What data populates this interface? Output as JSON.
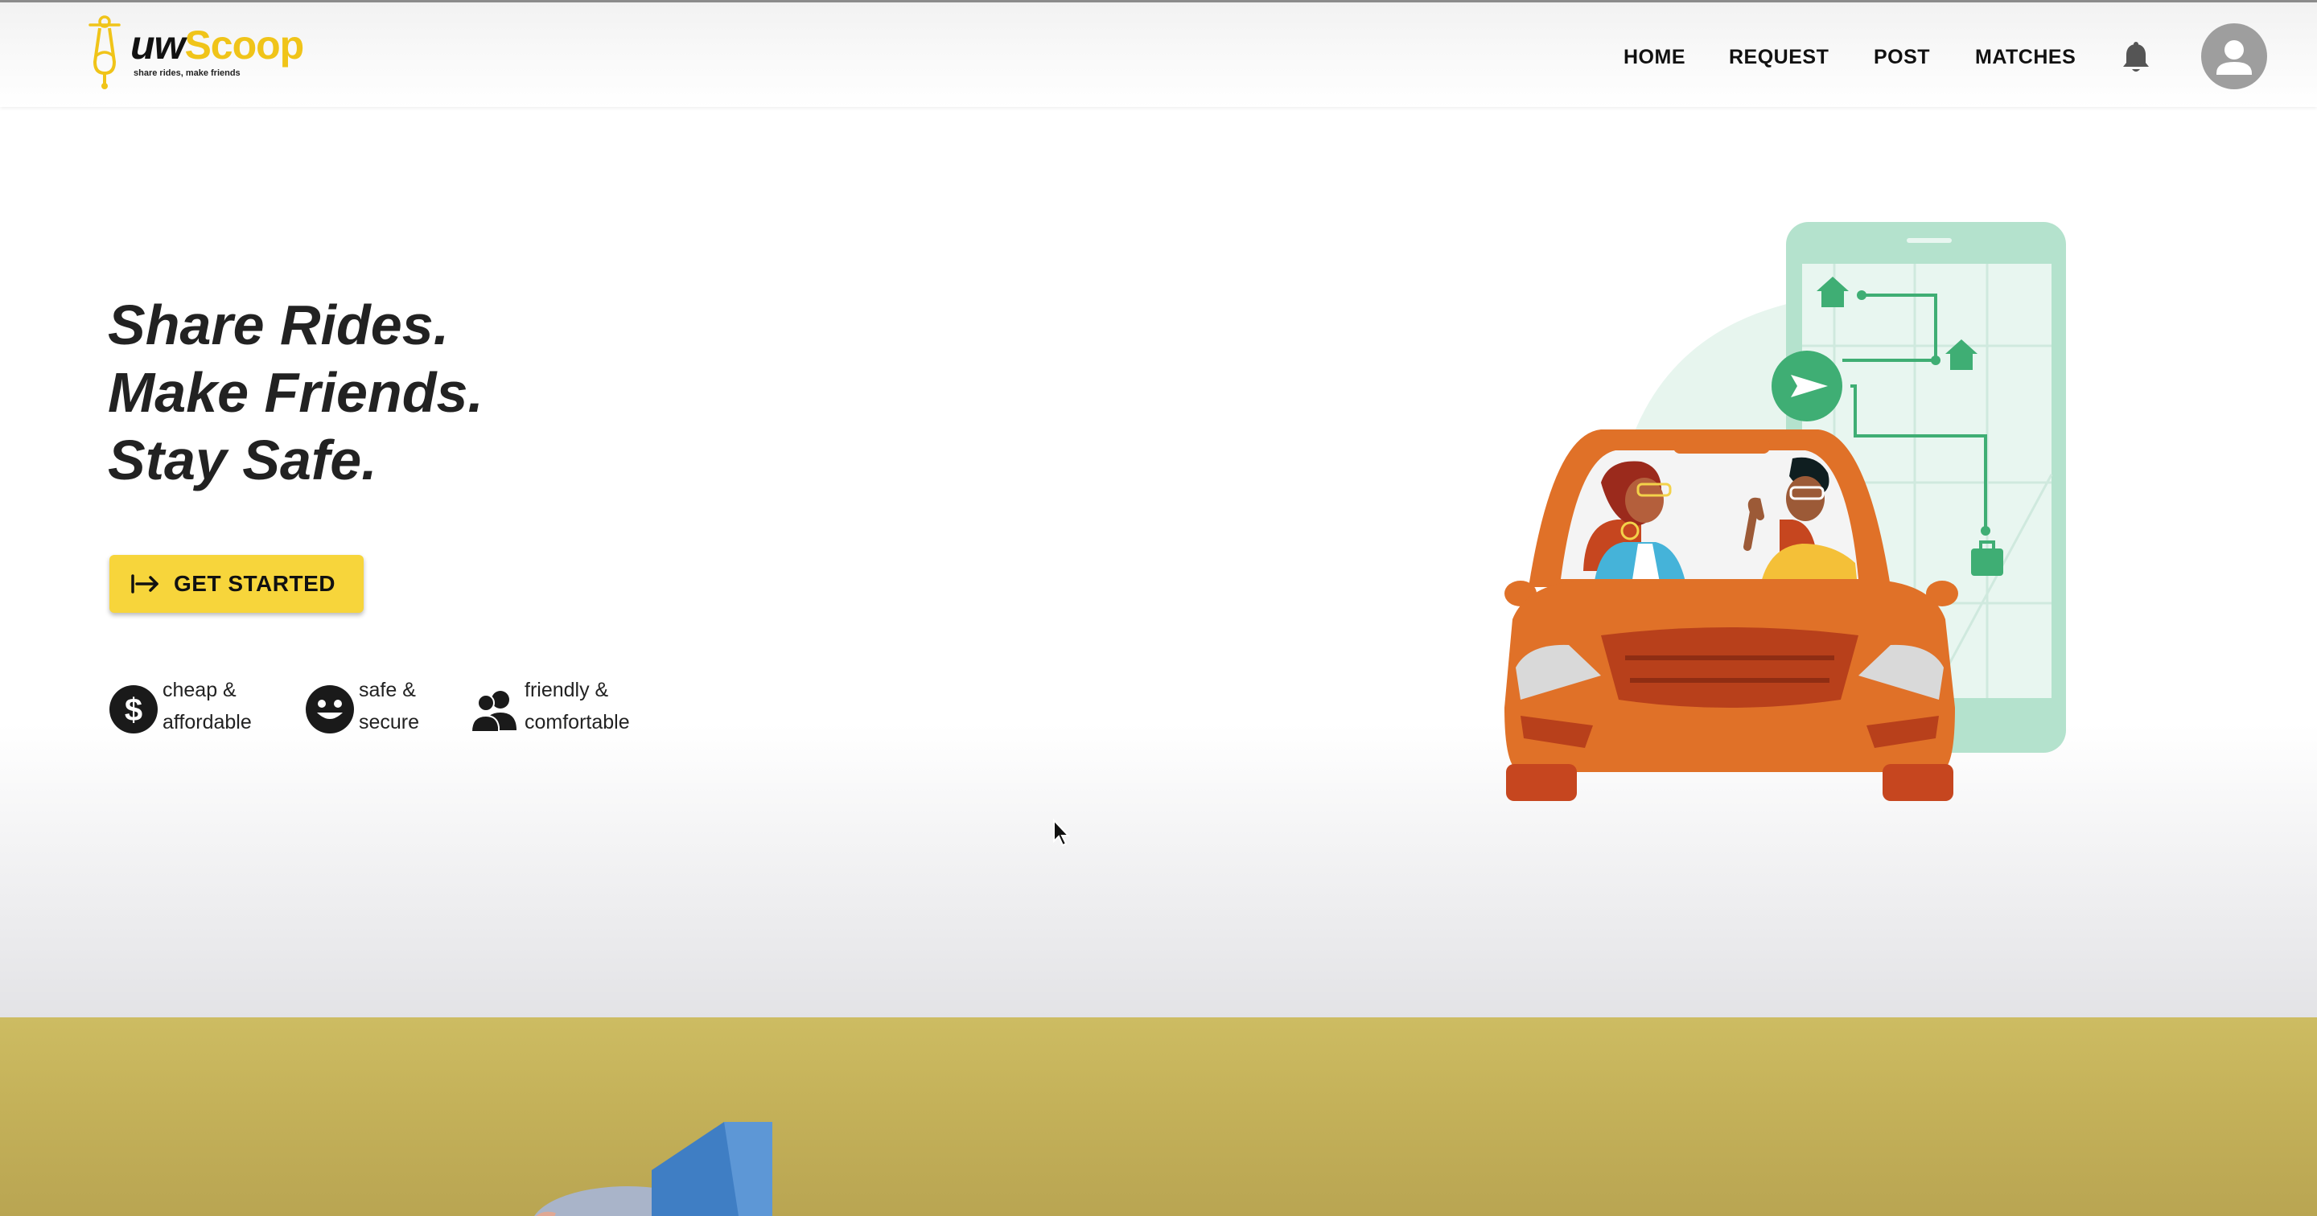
{
  "brand": {
    "name_part1": "uw",
    "name_part2": "Scoop",
    "tagline": "share rides, make friends",
    "colors": {
      "accent_yellow": "#f7d53b",
      "logo_yellow": "#f0c419",
      "band_olive": "#c4b159"
    }
  },
  "nav": {
    "items": [
      {
        "label": "HOME"
      },
      {
        "label": "REQUEST"
      },
      {
        "label": "POST"
      },
      {
        "label": "MATCHES"
      }
    ],
    "bell_icon": "bell-icon",
    "avatar_icon": "user-avatar-icon"
  },
  "hero": {
    "headline_lines": [
      "Share Rides.",
      "Make Friends.",
      "Stay Safe."
    ],
    "cta_label": "GET STARTED",
    "cta_icon": "arrow-right-to-line-icon",
    "features": [
      {
        "icon": "dollar-circle-icon",
        "line1": "cheap &",
        "line2": "affordable"
      },
      {
        "icon": "smiley-face-icon",
        "line1": "safe &",
        "line2": "secure"
      },
      {
        "icon": "people-group-icon",
        "line1": "friendly &",
        "line2": "comfortable"
      }
    ]
  }
}
